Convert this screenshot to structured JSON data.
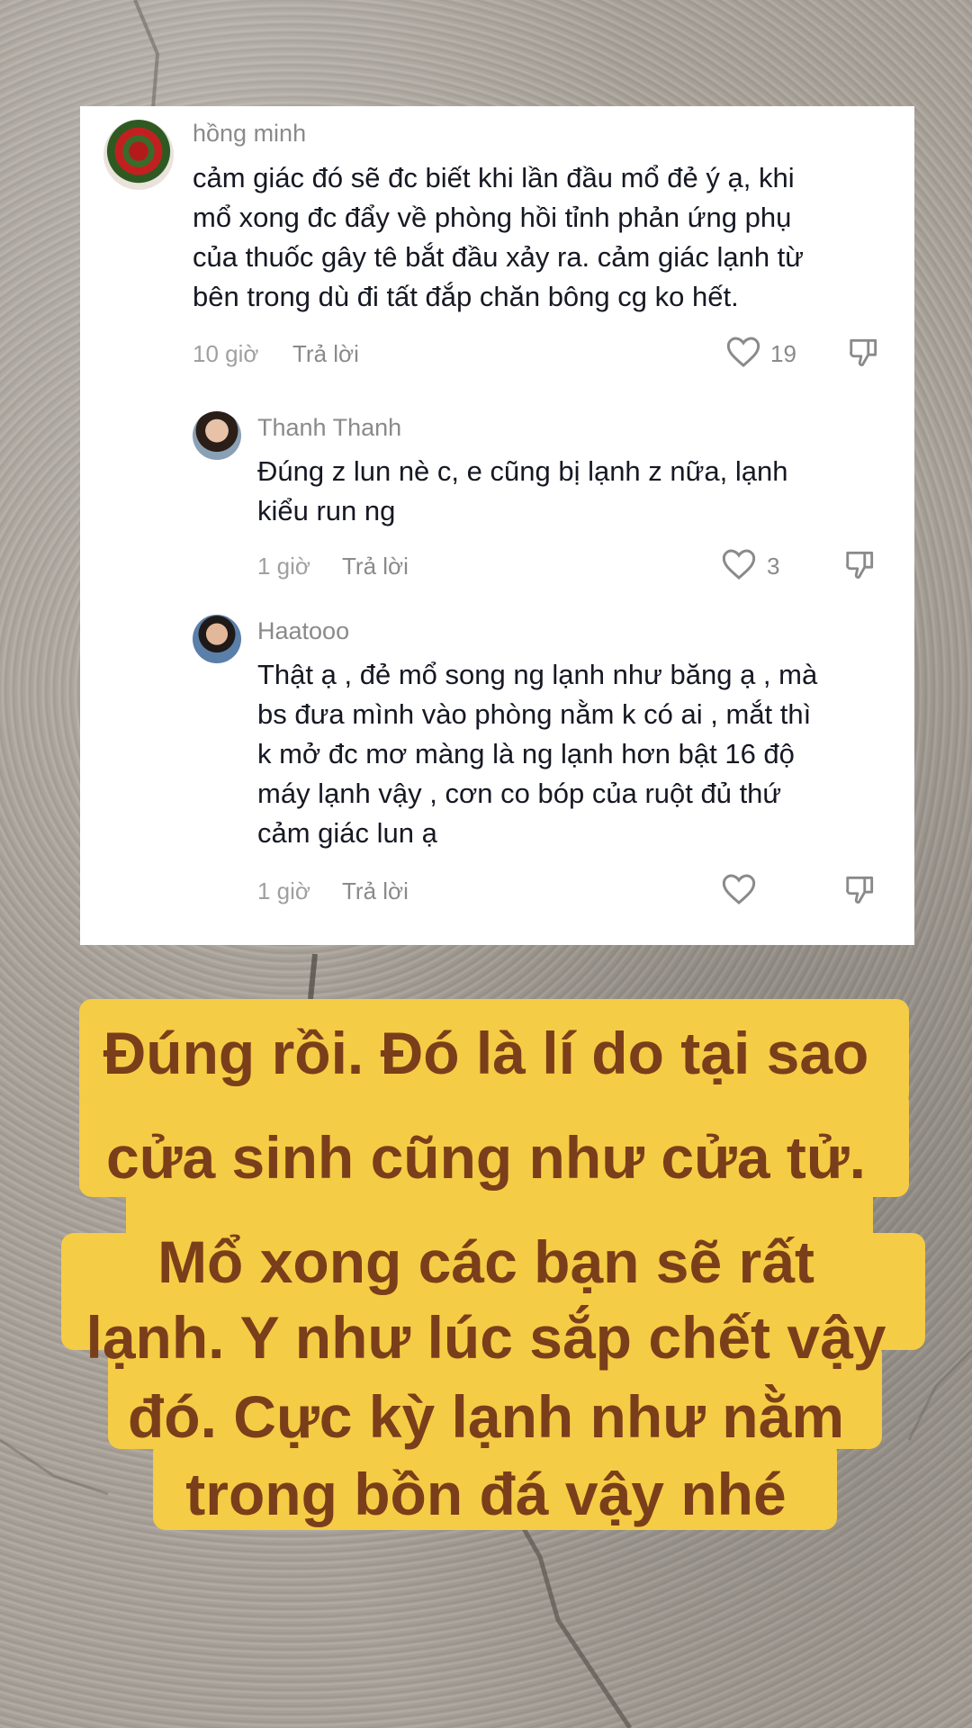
{
  "comments": [
    {
      "username": "hồng minh",
      "lines": [
        "cảm giác đó sẽ đc biết khi lần đầu mổ đẻ ý ạ, khi",
        "mổ xong đc đẩy về phòng hồi tỉnh phản ứng phụ",
        "của thuốc gây tê bắt đầu xảy ra. cảm giác lạnh từ",
        "bên trong dù đi tất đắp chăn bông cg ko hết."
      ],
      "time": "10 giờ",
      "reply_label": "Trả lời",
      "likes": "19"
    },
    {
      "username": "Thanh Thanh",
      "lines": [
        "Đúng z lun nè c, e cũng bị lạnh z nữa, lạnh",
        "kiểu run ng"
      ],
      "time": "1 giờ",
      "reply_label": "Trả lời",
      "likes": "3"
    },
    {
      "username": "Haatooo",
      "lines": [
        "Thật ạ , đẻ mổ song ng lạnh như băng ạ , mà",
        "bs đưa mình vào phòng nằm k có ai , mắt thì",
        "k mở đc mơ màng là ng lạnh hơn bật 16 độ",
        "máy lạnh vậy , cơn co bóp của ruột đủ thứ",
        "cảm giác lun ạ"
      ],
      "time": "1 giờ",
      "reply_label": "Trả lời",
      "likes": ""
    }
  ],
  "caption": {
    "lines": [
      "Đúng rồi. Đó là lí do tại sao",
      "cửa sinh cũng như cửa tử.",
      "Mổ xong các bạn sẽ rất",
      "lạnh. Y như lúc sắp chết vậy",
      "đó. Cực kỳ lạnh như nằm",
      "trong bồn đá vậy nhé"
    ],
    "background_color": "#f5cc45",
    "text_color": "#7a3e1a"
  },
  "icons": {
    "like": "heart-outline-icon",
    "dislike": "thumbs-down-icon"
  }
}
